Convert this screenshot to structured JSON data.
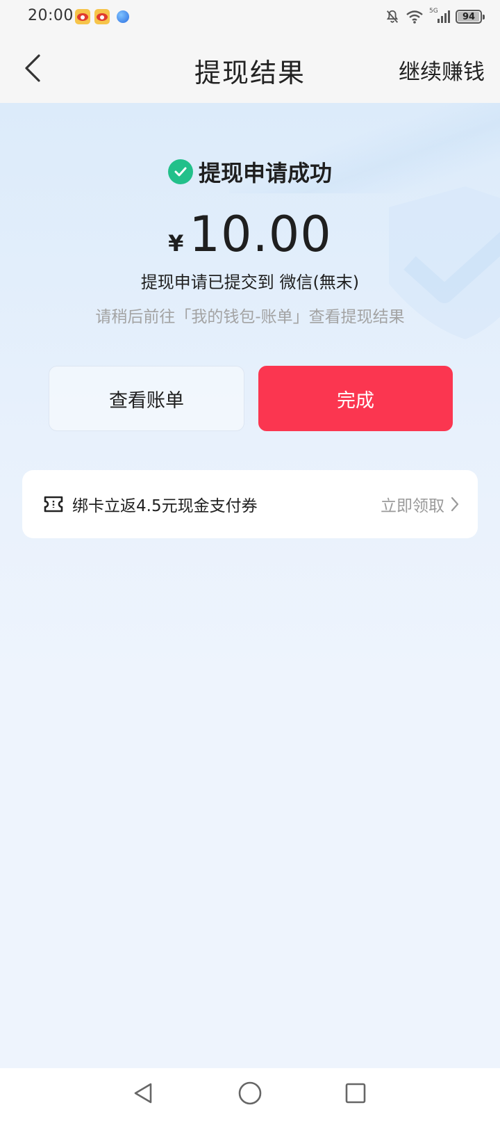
{
  "status_bar": {
    "time": "20:00",
    "battery_level": "94",
    "network_label": "5G"
  },
  "nav": {
    "title": "提现结果",
    "action_label": "继续赚钱"
  },
  "result": {
    "title": "提现申请成功",
    "currency_symbol": "¥",
    "amount": "10.00",
    "submitted_text": "提现申请已提交到 微信(無末)",
    "hint_text": "请稍后前往「我的钱包-账单」查看提现结果"
  },
  "buttons": {
    "view_bill_label": "查看账单",
    "done_label": "完成"
  },
  "promo": {
    "text": "绑卡立返4.5元现金支付券",
    "action_label": "立即领取"
  },
  "colors": {
    "primary": "#fb3650",
    "success": "#22c08a",
    "hint": "#a3a3a3",
    "page_background": "#eef4fd"
  },
  "icons": {
    "back": "chevron-left-icon",
    "success": "check-circle-icon",
    "promo": "ticket-icon",
    "promo_action": "chevron-right-icon"
  }
}
